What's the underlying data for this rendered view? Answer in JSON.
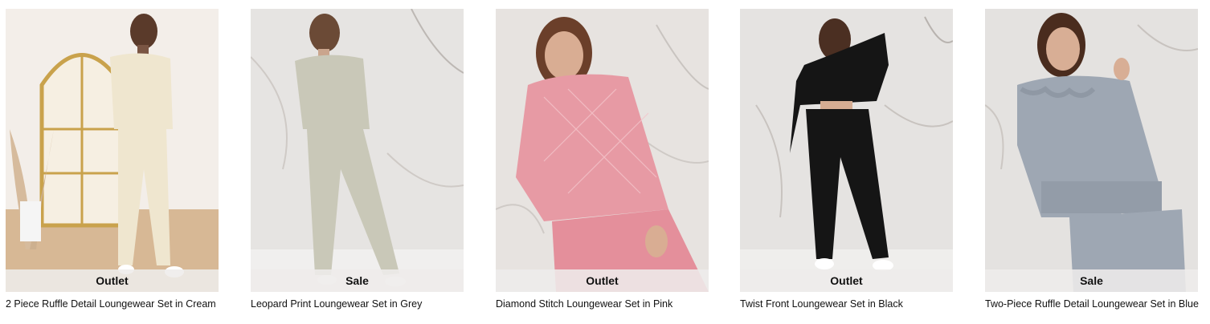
{
  "products": [
    {
      "badge": "Outlet",
      "title": "2 Piece Ruffle Detail Loungewear Set in Cream",
      "garment_color": "#efe6cf",
      "backdrop_color": "#efe9e3"
    },
    {
      "badge": "Sale",
      "title": "Leopard Print Loungewear Set in Grey",
      "garment_color": "#c9c8b8",
      "backdrop_color": "#e4e2e0"
    },
    {
      "badge": "Outlet",
      "title": "Diamond Stitch Loungewear Set in Pink",
      "garment_color": "#e79aa4",
      "backdrop_color": "#e6e2df"
    },
    {
      "badge": "Outlet",
      "title": "Twist Front Loungewear Set in Black",
      "garment_color": "#151515",
      "backdrop_color": "#e5e3e1"
    },
    {
      "badge": "Sale",
      "title": "Two-Piece Ruffle Detail Loungewear Set in Blue",
      "garment_color": "#9ea7b3",
      "backdrop_color": "#e4e2e0"
    }
  ]
}
